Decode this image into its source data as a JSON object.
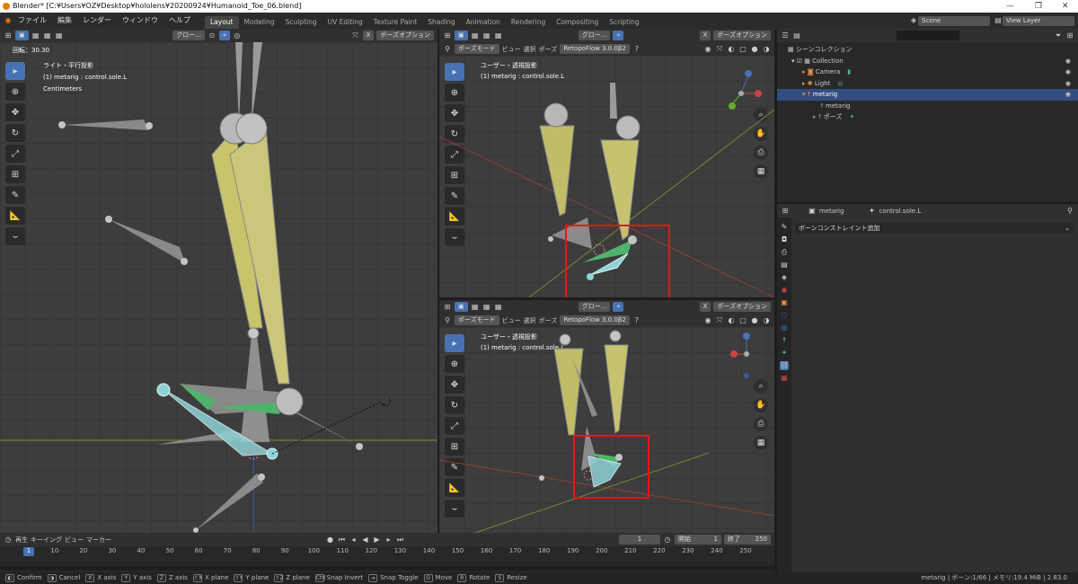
{
  "window": {
    "title": "Blender* [C:¥Users¥OZ¥Desktop¥hololens¥20200924¥Humanoid_Toe_06.blend]",
    "controls": [
      "—",
      "❐",
      "✕"
    ]
  },
  "menu": [
    "ファイル",
    "編集",
    "レンダー",
    "ウィンドウ",
    "ヘルプ"
  ],
  "workspaces": [
    "Layout",
    "Modeling",
    "Sculpting",
    "UV Editing",
    "Texture Paint",
    "Shading",
    "Animation",
    "Rendering",
    "Compositing",
    "Scripting"
  ],
  "top_right": {
    "scene": "Scene",
    "view_layer": "View Layer"
  },
  "left_viewport": {
    "transform_orientation": "グロー...",
    "pose_options": "ポーズオプション",
    "rotation_readout": "回転：30.30",
    "view_name": "ライト・平行投影",
    "active_bone": "(1) metarig : control.sole.L",
    "units": "Centimeters"
  },
  "right_viewport_header": {
    "mode": "ポーズモード",
    "view": "ビュー",
    "select": "選択",
    "pose": "ポーズ",
    "addon": "RetopoFlow 3.0.0β2",
    "transform_orientation": "グロー...",
    "pose_options": "ポーズオプション"
  },
  "top_right_viewport": {
    "view_name": "ユーザー・透視投影",
    "active_bone": "(1) metarig : control.sole.L"
  },
  "bottom_right_viewport": {
    "view_name": "ユーザー・透視投影",
    "active_bone": "(1) metarig : control.sole.L"
  },
  "outliner": {
    "search_placeholder": "",
    "rows": [
      {
        "label": "シーンコレクション",
        "indent": 0,
        "selected": false
      },
      {
        "label": "Collection",
        "indent": 1,
        "selected": false
      },
      {
        "label": "Camera",
        "indent": 2,
        "selected": false
      },
      {
        "label": "Light",
        "indent": 2,
        "selected": false
      },
      {
        "label": "metarig",
        "indent": 2,
        "selected": true
      },
      {
        "label": "metarig",
        "indent": 3,
        "selected": false
      },
      {
        "label": "ポーズ",
        "indent": 3,
        "selected": false
      }
    ]
  },
  "properties": {
    "object": "metarig",
    "bone": "control.sole.L",
    "add_constraint": "ボーンコンストレイント追加"
  },
  "timeline": {
    "playback": "再生",
    "keying": "キーイング",
    "view": "ビュー",
    "marker": "マーカー",
    "current_frame": "1",
    "start_label": "開始",
    "start": "1",
    "end_label": "終了",
    "end": "250",
    "ruler": [
      "1",
      "10",
      "20",
      "30",
      "40",
      "50",
      "60",
      "70",
      "80",
      "90",
      "100",
      "110",
      "120",
      "130",
      "140",
      "150",
      "160",
      "170",
      "180",
      "190",
      "200",
      "210",
      "220",
      "230",
      "240",
      "250"
    ]
  },
  "status": {
    "hints": [
      {
        "key": "◐",
        "label": "Confirm"
      },
      {
        "key": "◑",
        "label": "Cancel"
      },
      {
        "key": "X",
        "label": "X axis"
      },
      {
        "key": "Y",
        "label": "Y axis"
      },
      {
        "key": "Z",
        "label": "Z axis"
      },
      {
        "key": "⇧X",
        "label": "X plane"
      },
      {
        "key": "⇧Y",
        "label": "Y plane"
      },
      {
        "key": "⇧Z",
        "label": "Z plane"
      },
      {
        "key": "Ctrl",
        "label": "Snap Invert"
      },
      {
        "key": "⇥",
        "label": "Snap Toggle"
      },
      {
        "key": "G",
        "label": "Move"
      },
      {
        "key": "R",
        "label": "Rotate"
      },
      {
        "key": "S",
        "label": "Resize"
      }
    ],
    "right": "metarig | ボーン:1/66 | メモリ:19.4 MiB | 2.83.0"
  },
  "colors": {
    "accent": "#4772b3",
    "highlight_box": "#e01818",
    "bone_yellow": "#c8c46a",
    "bone_green": "#4fb36c",
    "bone_selected": "#8fd2d6"
  }
}
